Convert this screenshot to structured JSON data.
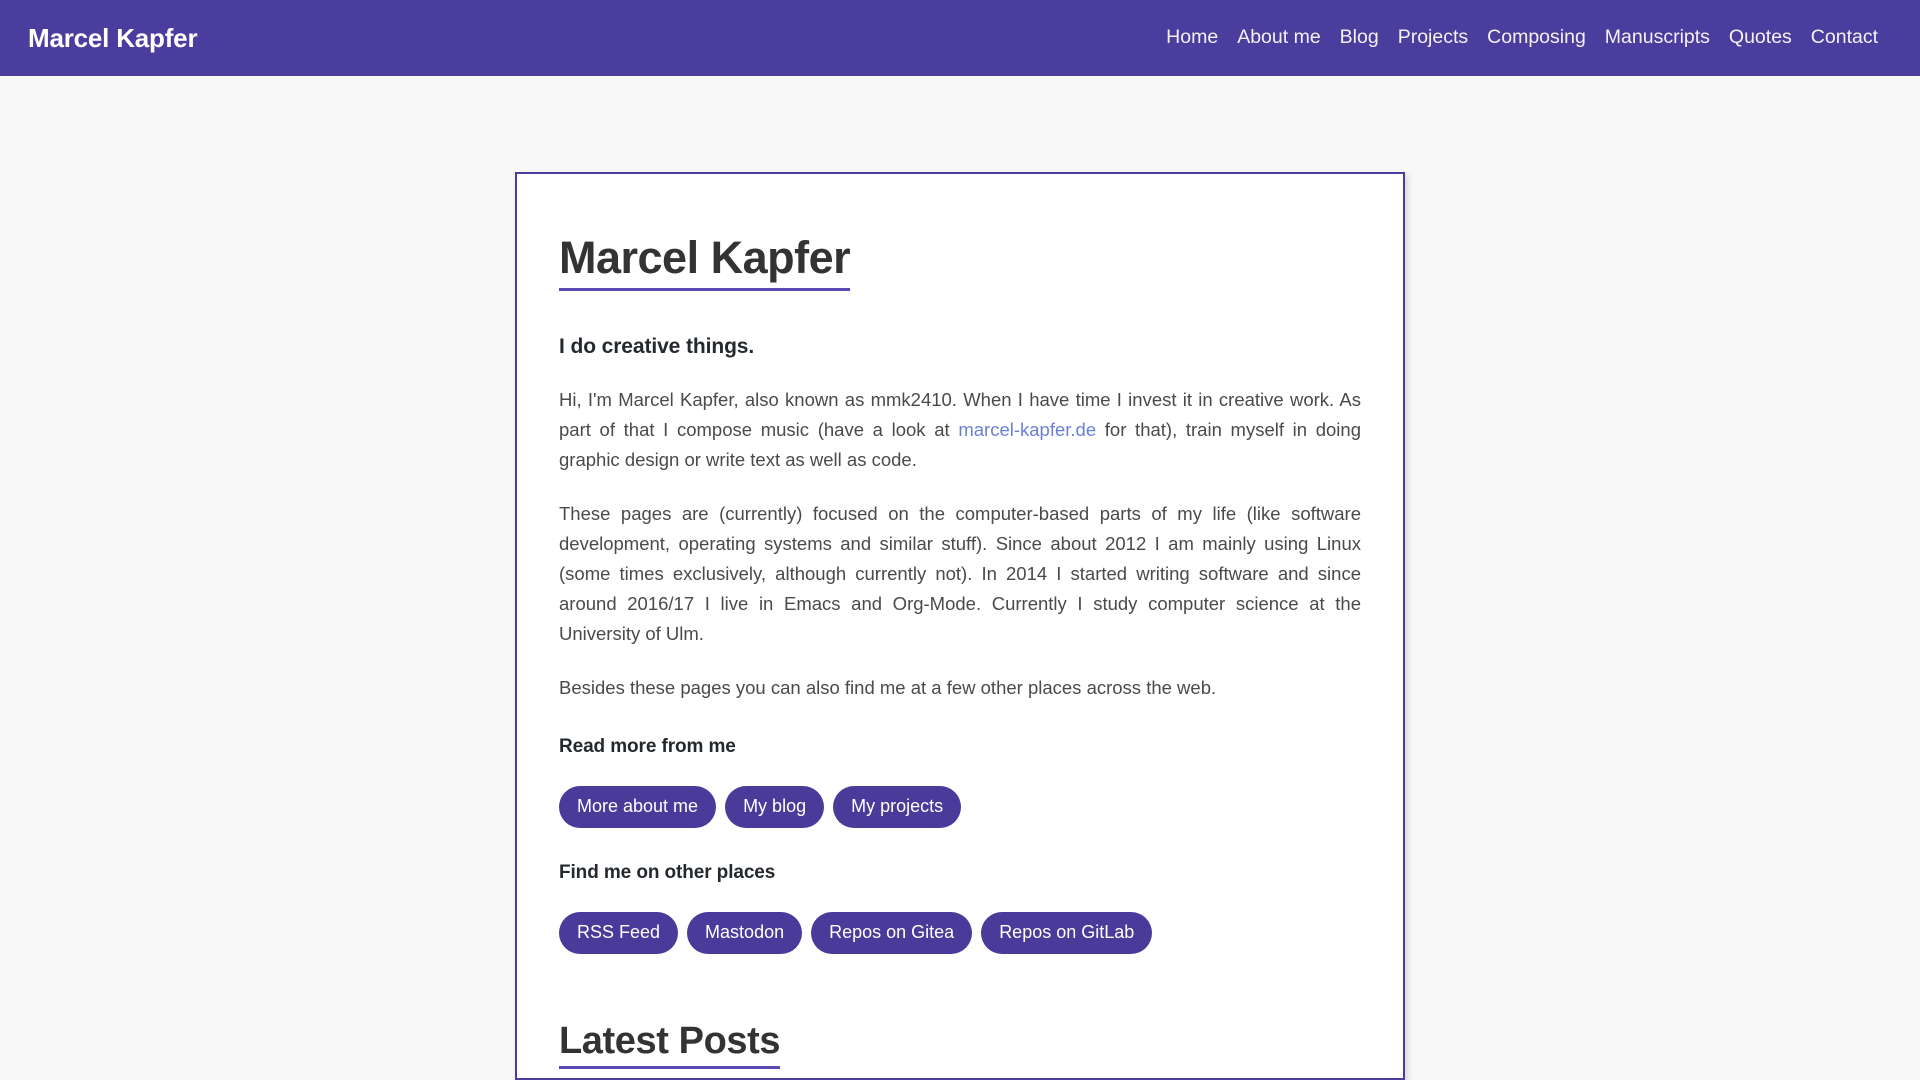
{
  "header": {
    "brand": "Marcel Kapfer",
    "nav": [
      {
        "label": "Home"
      },
      {
        "label": "About me"
      },
      {
        "label": "Blog"
      },
      {
        "label": "Projects"
      },
      {
        "label": "Composing"
      },
      {
        "label": "Manuscripts"
      },
      {
        "label": "Quotes"
      },
      {
        "label": "Contact"
      }
    ]
  },
  "main": {
    "title": "Marcel Kapfer",
    "subtitle": "I do creative things.",
    "paragraph1_before_link": "Hi, I'm Marcel Kapfer, also known as mmk2410. When I have time I invest it in creative work. As part of that I compose music (have a look at ",
    "paragraph1_link": "marcel-kapfer.de",
    "paragraph1_after_link": " for that), train myself in doing graphic design or write text as well as code.",
    "paragraph2": "These pages are (currently) focused on the computer-based parts of my life (like software development, operating systems and similar stuff). Since about 2012 I am mainly using Linux (some times exclusively, although currently not). In 2014 I started writing software and since around 2016/17 I live in Emacs and Org-Mode. Currently I study computer science at the University of Ulm.",
    "paragraph3": "Besides these pages you can also find me at a few other places across the web.",
    "read_more_heading": "Read more from me",
    "read_more_buttons": [
      {
        "label": "More about me"
      },
      {
        "label": "My blog"
      },
      {
        "label": "My projects"
      }
    ],
    "find_me_heading": "Find me on other places",
    "find_me_buttons": [
      {
        "label": "RSS Feed"
      },
      {
        "label": "Mastodon"
      },
      {
        "label": "Repos on Gitea"
      },
      {
        "label": "Repos on GitLab"
      }
    ],
    "latest_posts_title": "Latest Posts"
  },
  "colors": {
    "header_purple": "#4b3d9e",
    "button_purple": "#4a3a9a",
    "underline_purple": "#5b4ab5",
    "link_blue": "#6b7fd7",
    "page_background": "#f8f8f8"
  }
}
